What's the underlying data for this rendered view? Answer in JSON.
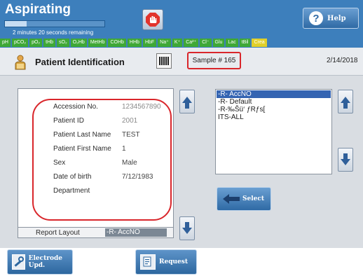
{
  "header": {
    "title": "Aspirating",
    "progress": 0.22,
    "remaining": "2 minutes 20 seconds remaining",
    "help_label": "Help",
    "parameters": [
      {
        "label": "pH",
        "highlight": false
      },
      {
        "label": "pCO₂",
        "highlight": false
      },
      {
        "label": "pO₂",
        "highlight": false
      },
      {
        "label": "tHb",
        "highlight": false
      },
      {
        "label": "sO₂",
        "highlight": false
      },
      {
        "label": "O₂Hb",
        "highlight": false
      },
      {
        "label": "MetHb",
        "highlight": false
      },
      {
        "label": "COHb",
        "highlight": false
      },
      {
        "label": "HHb",
        "highlight": false
      },
      {
        "label": "HbF",
        "highlight": false
      },
      {
        "label": "Na⁺",
        "highlight": false
      },
      {
        "label": "K⁺",
        "highlight": false
      },
      {
        "label": "Ca²⁺",
        "highlight": false
      },
      {
        "label": "Cl⁻",
        "highlight": false
      },
      {
        "label": "Glu",
        "highlight": false
      },
      {
        "label": "Lac",
        "highlight": false
      },
      {
        "label": "tBil",
        "highlight": false
      },
      {
        "label": "Crea",
        "highlight": true
      }
    ],
    "colors": {
      "bar": "#3d7fbc",
      "param": "#3fa836",
      "param_highlight": "#e1d02a"
    }
  },
  "titlebar": {
    "title": "Patient Identification",
    "sample": "Sample # 165",
    "date": "2/14/2018"
  },
  "patient_info": {
    "fields": [
      {
        "label": "Accession No.",
        "value": "1234567890",
        "muted": true
      },
      {
        "label": "Patient ID",
        "value": "2001",
        "muted": true
      },
      {
        "label": "Patient Last Name",
        "value": "TEST",
        "muted": false
      },
      {
        "label": "Patient First Name",
        "value": "1",
        "muted": false
      },
      {
        "label": "Sex",
        "value": "Male",
        "muted": false
      },
      {
        "label": "Date of birth",
        "value": "7/12/1983",
        "muted": false
      },
      {
        "label": "Department",
        "value": "",
        "muted": false
      }
    ],
    "report_layout_label": "Report Layout",
    "report_layout_value": "-R- AccNO"
  },
  "layout_list": {
    "items": [
      {
        "label": "-R- AccNO",
        "selected": true
      },
      {
        "label": "-R- Default",
        "selected": false
      },
      {
        "label": "-R-‰Šü‘ ƒRƒs[",
        "selected": false
      },
      {
        "label": "ITS-ALL",
        "selected": false
      }
    ],
    "select_label": "Select"
  },
  "footer": {
    "electrode_label": "Electrode Upd.",
    "request_label": "Request"
  },
  "colors": {
    "highlight_ring": "#d9262b",
    "selection": "#3464b2",
    "stop": "#e2342d"
  }
}
